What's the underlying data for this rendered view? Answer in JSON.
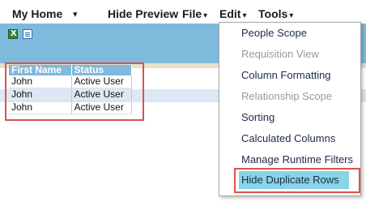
{
  "menubar": {
    "my_home": "My Home",
    "dropdown_arrow": "▾",
    "hide_preview": "Hide Preview",
    "file": "File",
    "edit": "Edit",
    "tools": "Tools"
  },
  "toolbar": {
    "icons": [
      "excel-export-icon",
      "document-icon"
    ]
  },
  "table": {
    "headers": [
      "First Name",
      "Status"
    ],
    "rows": [
      [
        "John",
        "Active User"
      ],
      [
        "John",
        "Active User"
      ],
      [
        "John",
        "Active User"
      ]
    ]
  },
  "tools_menu": {
    "items": [
      {
        "label": "People Scope",
        "enabled": true
      },
      {
        "label": "Requisition View",
        "enabled": false
      },
      {
        "label": "Column Formatting",
        "enabled": true
      },
      {
        "label": "Relationship Scope",
        "enabled": false
      },
      {
        "label": "Sorting",
        "enabled": true
      },
      {
        "label": "Calculated Columns",
        "enabled": true
      },
      {
        "label": "Manage Runtime Filters",
        "enabled": true
      },
      {
        "label": "Hide Duplicate Rows",
        "enabled": true,
        "selected": true
      }
    ]
  },
  "colors": {
    "accent_blue": "#7fb9dc",
    "highlight_red": "#d9534f",
    "selected_item": "#88d3e6"
  }
}
